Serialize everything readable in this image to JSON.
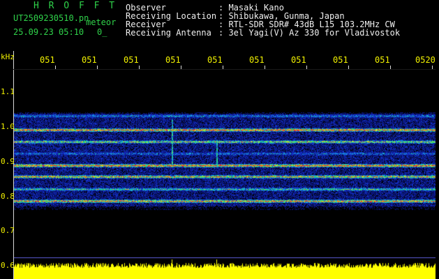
{
  "header": {
    "app_name": "H R O F F T",
    "file_name": "UT2509230510.pn",
    "file_type": "meteor",
    "date_time": "25.09.23 05:10",
    "count": "0_",
    "info": [
      {
        "label": "Observer",
        "value": ": Masaki Kano"
      },
      {
        "label": "Receiving Location",
        "value": ": Shibukawa, Gunma, Japan"
      },
      {
        "label": "Receiver",
        "value": ": RTL-SDR SDR# 43dB L15 103.2MHz CW"
      },
      {
        "label": "Receiving Antenna",
        "value": ": 3el Yagi(V) Az 330 for Vladivostok"
      }
    ]
  },
  "y_axis": {
    "unit": "kHz",
    "ticks": [
      "1.1",
      "1.0",
      "0.9",
      "0.8",
      "0.7",
      "0.6"
    ]
  },
  "x_axis": {
    "ticks": [
      "051",
      "051",
      "051",
      "051",
      "051",
      "051",
      "051",
      "051",
      "051",
      "0520"
    ]
  },
  "colors": {
    "background": "#000000",
    "header_title": "#2fd24a",
    "header_text": "#f0f0f0",
    "axis_labels": "#f2f200",
    "amplitude": "#ffff00"
  }
}
